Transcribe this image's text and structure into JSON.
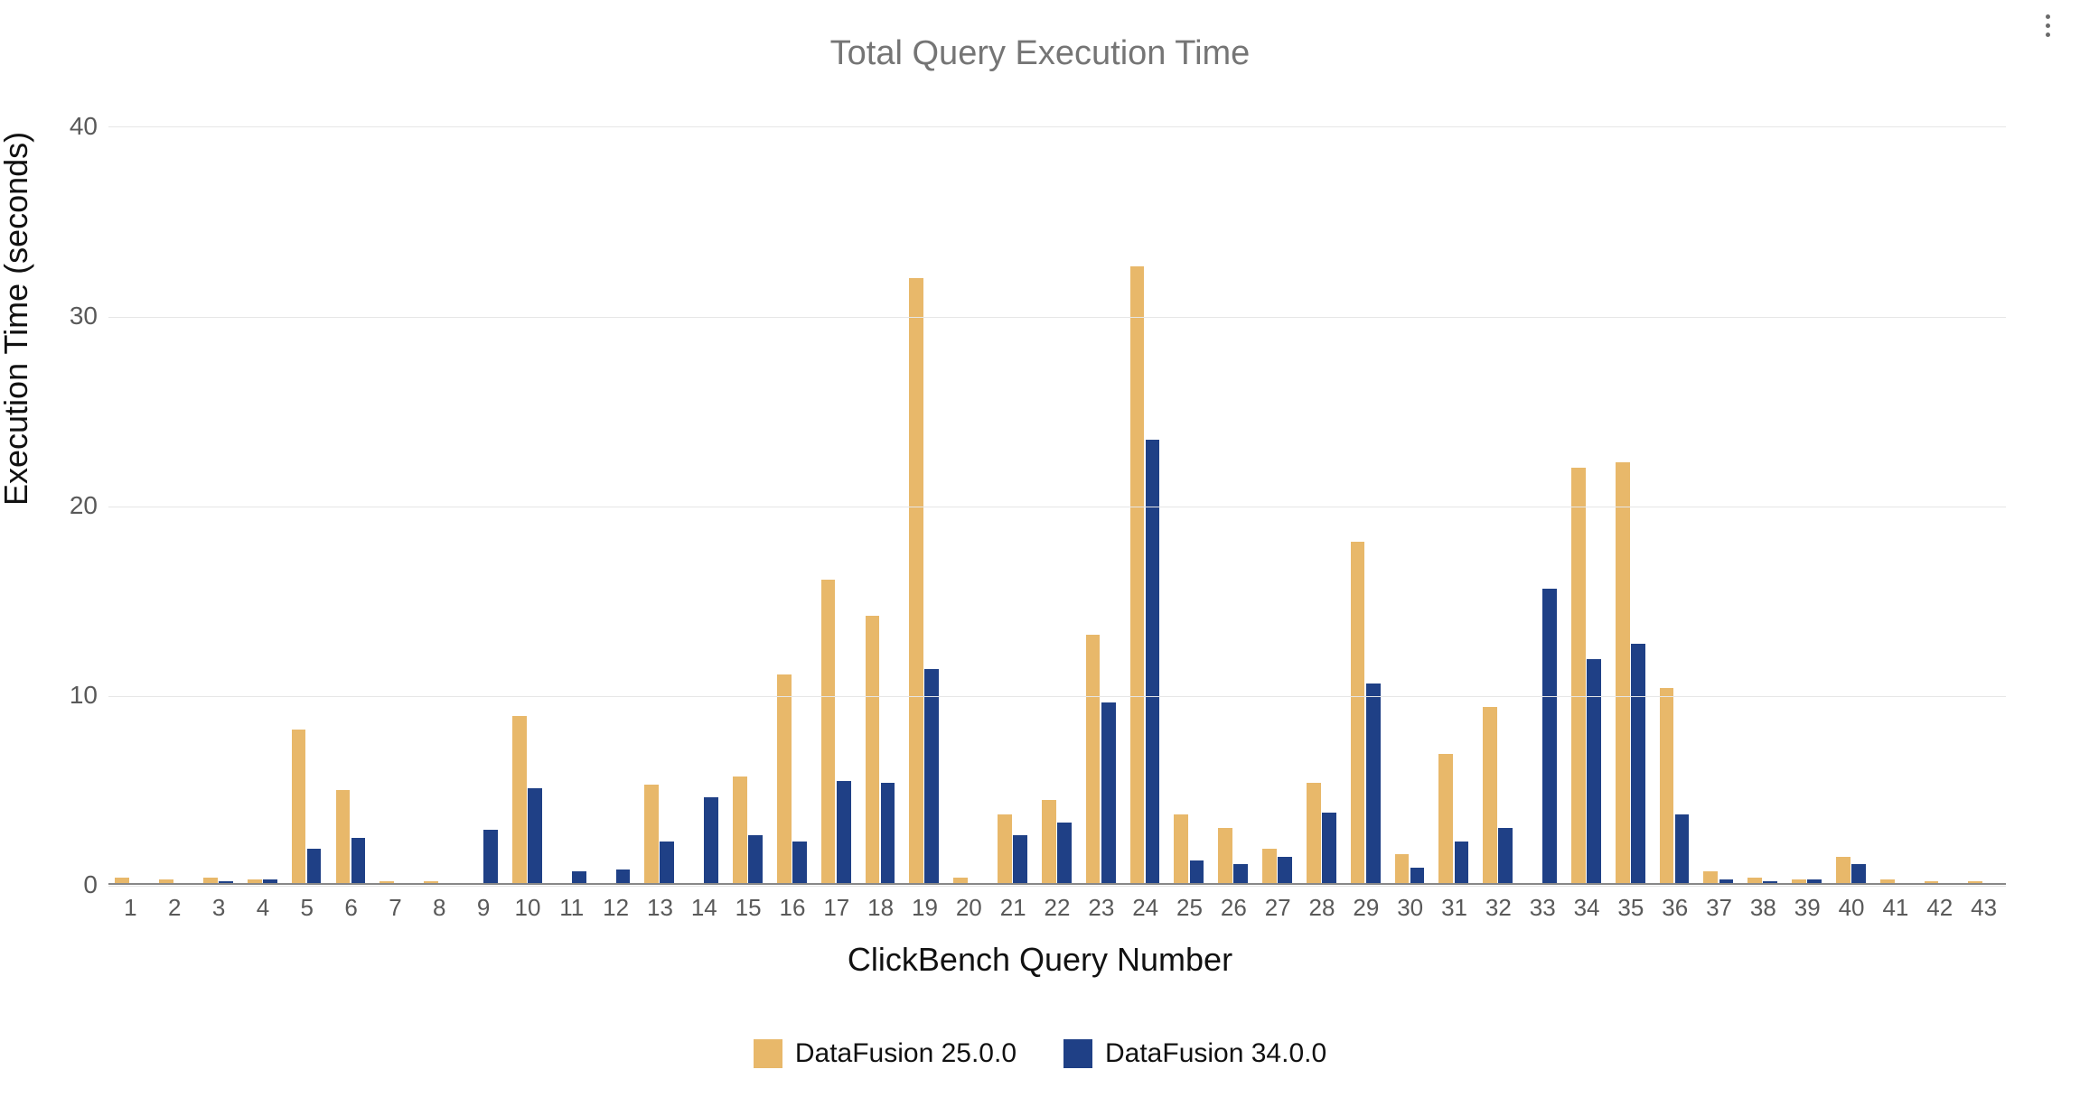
{
  "chart_data": {
    "type": "bar",
    "title": "Total Query Execution Time",
    "xlabel": "ClickBench Query Number",
    "ylabel": "Execution Time (seconds)",
    "ylim": [
      0,
      40
    ],
    "yticks": [
      0,
      10,
      20,
      30,
      40
    ],
    "categories": [
      "1",
      "2",
      "3",
      "4",
      "5",
      "6",
      "7",
      "8",
      "9",
      "10",
      "11",
      "12",
      "13",
      "14",
      "15",
      "16",
      "17",
      "18",
      "19",
      "20",
      "21",
      "22",
      "23",
      "24",
      "25",
      "26",
      "27",
      "28",
      "29",
      "30",
      "31",
      "32",
      "33",
      "34",
      "35",
      "36",
      "37",
      "38",
      "39",
      "40",
      "41",
      "42",
      "43"
    ],
    "series": [
      {
        "name": "DataFusion 25.0.0",
        "color": "#e8b86a",
        "values": [
          0.4,
          0.3,
          0.4,
          0.3,
          8.2,
          5.0,
          0.2,
          0.2,
          0.1,
          8.9,
          0.1,
          0.1,
          5.3,
          0.1,
          5.7,
          11.1,
          16.1,
          14.2,
          32.0,
          0.4,
          3.7,
          4.5,
          13.2,
          32.6,
          3.7,
          3.0,
          1.9,
          5.4,
          18.1,
          1.6,
          6.9,
          9.4,
          0.1,
          22.0,
          22.3,
          10.4,
          0.7,
          0.4,
          0.3,
          1.5,
          0.3,
          0.2,
          0.2
        ]
      },
      {
        "name": "DataFusion 34.0.0",
        "color": "#1f4086",
        "values": [
          0.0,
          0.0,
          0.2,
          0.3,
          1.9,
          2.5,
          0.0,
          0.0,
          2.9,
          5.1,
          0.7,
          0.8,
          2.3,
          4.6,
          2.6,
          2.3,
          5.5,
          5.4,
          11.4,
          0.1,
          2.6,
          3.3,
          9.6,
          23.5,
          1.3,
          1.1,
          1.5,
          3.8,
          10.6,
          0.9,
          2.3,
          3.0,
          15.6,
          11.9,
          12.7,
          3.7,
          0.3,
          0.2,
          0.3,
          1.1,
          0.1,
          0.1,
          0.1
        ]
      }
    ]
  },
  "menu_icon": "more-vert"
}
